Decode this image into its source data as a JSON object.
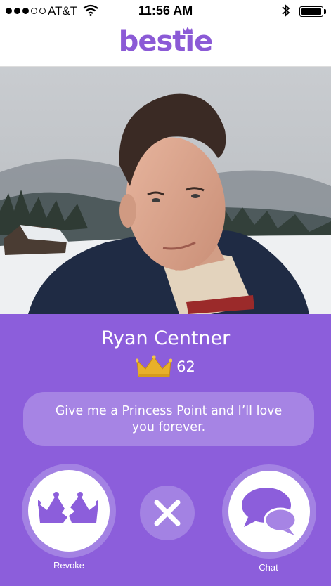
{
  "status_bar": {
    "carrier": "AT&T",
    "time": "11:56 AM",
    "signal_bars_filled": 3,
    "signal_bars_total": 5
  },
  "header": {
    "logo_text": "bestie"
  },
  "profile": {
    "name": "Ryan Centner",
    "crown_score": "62",
    "bio": "Give me a Princess Point and I’ll love you forever."
  },
  "actions": {
    "revoke_label": "Revoke",
    "chat_label": "Chat"
  },
  "colors": {
    "accent": "#8c5edb",
    "accent_light": "#a382e3",
    "crown_gold": "#e8b02a"
  }
}
